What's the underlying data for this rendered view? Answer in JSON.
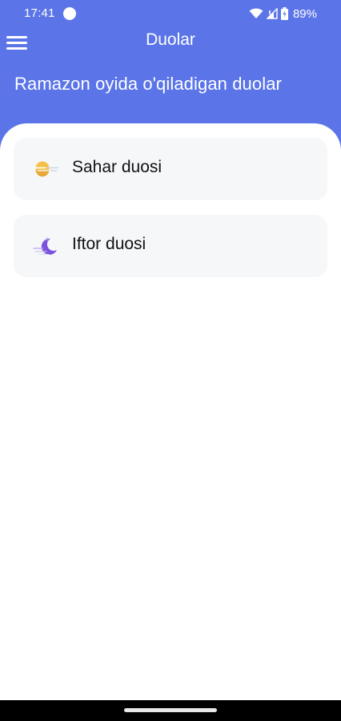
{
  "status_bar": {
    "time": "17:41",
    "battery": "89%",
    "icons": [
      "wifi-icon",
      "signal-icon",
      "battery-icon"
    ]
  },
  "app_bar": {
    "title": "Duolar",
    "menu_icon": "menu-icon"
  },
  "subtitle": "Ramazon oyida o'qiladigan duolar",
  "cards": [
    {
      "label": "Sahar duosi",
      "icon": "sun-icon"
    },
    {
      "label": "Iftor duosi",
      "icon": "moon-icon"
    }
  ],
  "colors": {
    "header": "#5b75e9",
    "card_background": "#f6f7f9",
    "sun": "#f5c04a",
    "moon": "#7b52e0"
  }
}
